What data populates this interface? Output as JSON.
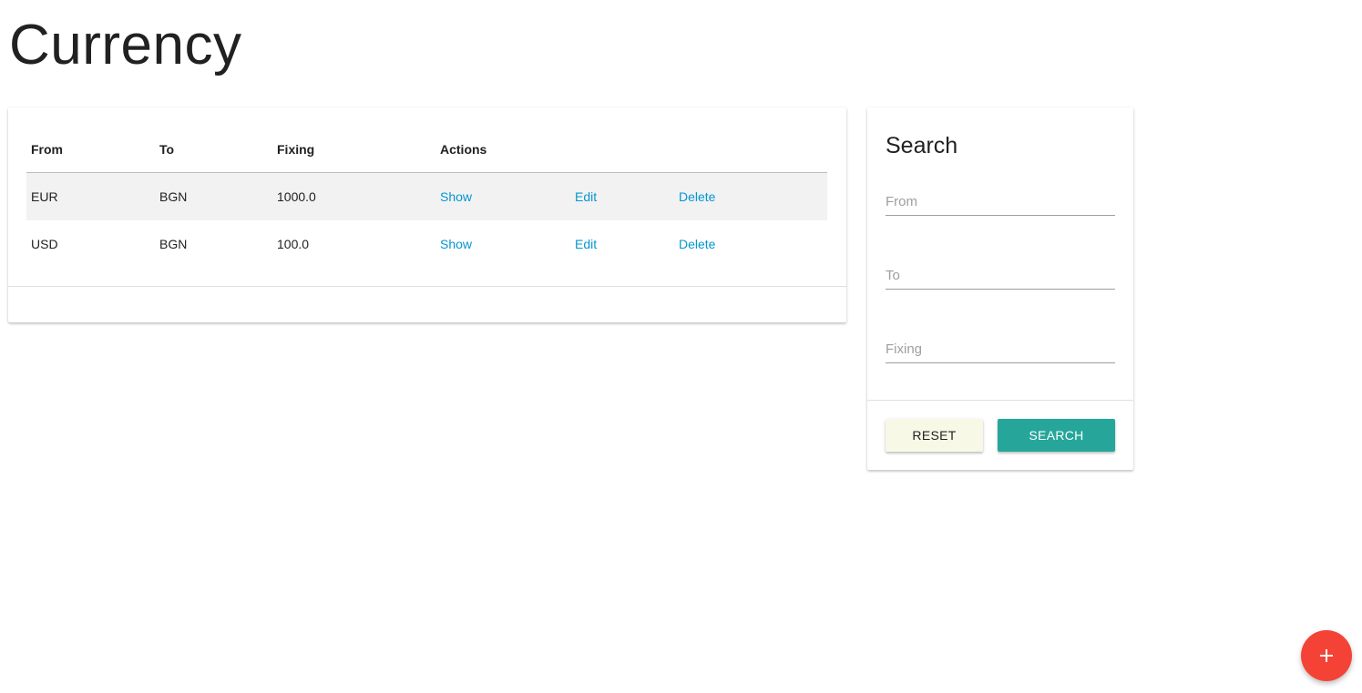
{
  "page": {
    "title": "Currency"
  },
  "table": {
    "headers": {
      "from": "From",
      "to": "To",
      "fixing": "Fixing",
      "actions": "Actions"
    },
    "rows": [
      {
        "from": "EUR",
        "to": "BGN",
        "fixing": "1000.0",
        "show": "Show",
        "edit": "Edit",
        "delete": "Delete"
      },
      {
        "from": "USD",
        "to": "BGN",
        "fixing": "100.0",
        "show": "Show",
        "edit": "Edit",
        "delete": "Delete"
      }
    ]
  },
  "search": {
    "title": "Search",
    "from_placeholder": "From",
    "to_placeholder": "To",
    "fixing_placeholder": "Fixing",
    "from_value": "",
    "to_value": "",
    "fixing_value": "",
    "reset_label": "RESET",
    "search_label": "SEARCH"
  },
  "fab": {
    "icon": "plus-icon"
  },
  "colors": {
    "link": "#0397d1",
    "search_button": "#26a69a",
    "reset_button": "#f8f8e6",
    "fab": "#f44336",
    "row_stripe": "#f2f2f2"
  }
}
